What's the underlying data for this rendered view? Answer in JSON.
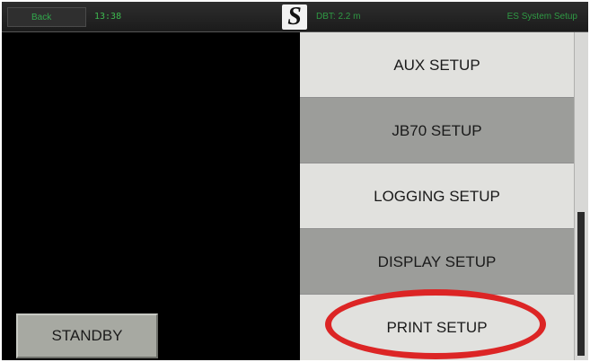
{
  "topbar": {
    "back_label": "Back",
    "time": "13:38",
    "logo_letter": "S",
    "dbt_readout": "DBT: 2.2 m",
    "system_title": "ES System Setup"
  },
  "left": {
    "standby_label": "STANDBY"
  },
  "menu": {
    "items": [
      {
        "label": "AUX SETUP"
      },
      {
        "label": "JB70 SETUP"
      },
      {
        "label": "LOGGING SETUP"
      },
      {
        "label": "DISPLAY SETUP"
      },
      {
        "label": "PRINT SETUP"
      }
    ]
  },
  "colors": {
    "status_text": "#31a84c",
    "highlight": "#dc2525",
    "menu_light": "#e1e1de",
    "menu_dark": "#9c9d9a"
  },
  "icons": {
    "logo": "brand-logo-icon"
  }
}
